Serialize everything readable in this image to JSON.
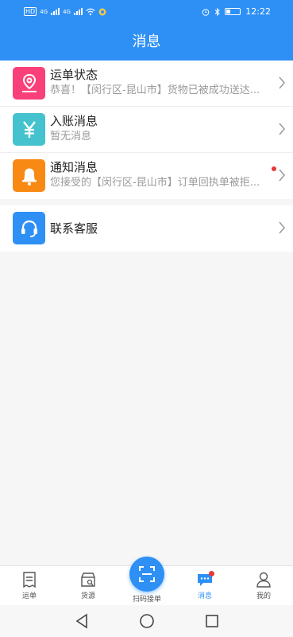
{
  "status_bar": {
    "left_labels": [
      "HD",
      "4G",
      "4G"
    ],
    "time": "12:22"
  },
  "header": {
    "title": "消息"
  },
  "messages": [
    {
      "title": "运单状态",
      "subtitle": "恭喜！【闵行区-昆山市】货物已被成功送达...",
      "icon": "location-pin-icon",
      "color": "#fa4078",
      "unread": false
    },
    {
      "title": "入账消息",
      "subtitle": "暂无消息",
      "icon": "yen-icon",
      "color": "#44c2ce",
      "unread": false
    },
    {
      "title": "通知消息",
      "subtitle": "您接受的【闵行区-昆山市】订单回执单被拒...",
      "icon": "bell-icon",
      "color": "#f88a14",
      "unread": true
    }
  ],
  "service": {
    "title": "联系客服",
    "icon": "headset-icon",
    "color": "#2e90f5"
  },
  "tabs": [
    {
      "label": "运单",
      "icon": "waybill-icon",
      "active": false
    },
    {
      "label": "货源",
      "icon": "cargo-search-icon",
      "active": false
    },
    {
      "label": "扫码接单",
      "icon": "scan-icon",
      "active": false
    },
    {
      "label": "消息",
      "icon": "chat-bubble-icon",
      "active": true,
      "badge": true
    },
    {
      "label": "我的",
      "icon": "user-icon",
      "active": false
    }
  ],
  "nav": {
    "buttons": [
      "back-icon",
      "home-icon",
      "recents-icon"
    ]
  },
  "colors": {
    "primary": "#2e90f5",
    "badge": "#e53935"
  }
}
